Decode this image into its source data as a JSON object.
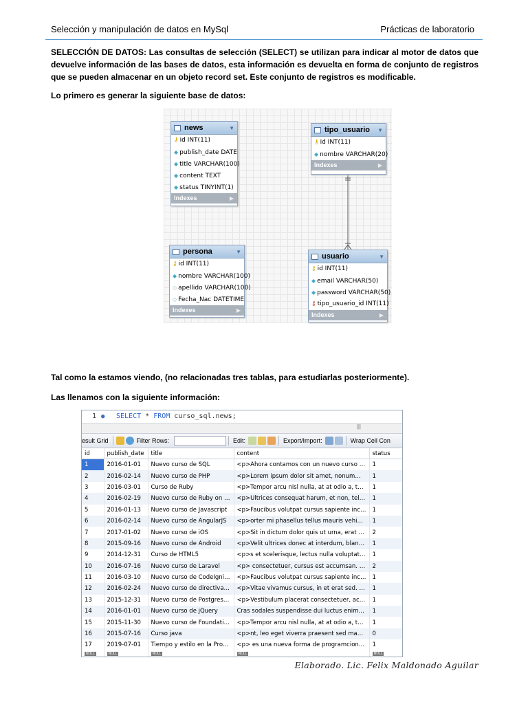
{
  "header": {
    "left": "Selección y manipulación de datos en   MySql",
    "right": "Prácticas de laboratorio"
  },
  "intro": {
    "lead": "SELECCIÓN DE DATOS:",
    "text": " Las consultas de selección (SELECT) se utilizan para indicar al motor de datos que devuelve información de las bases de datos, esta información es devuelta en forma de conjunto de registros que se pueden almacenar en un objeto record set. Este conjunto de registros es modificable."
  },
  "p1": "Lo primero es generar la siguiente base de datos:",
  "p2": "Tal como la estamos viendo, (no relacionadas tres tablas, para estudiarlas posteriormente).",
  "p3": "Las llenamos con la siguiente información:",
  "diagram": {
    "indexes_label": "Indexes",
    "news": {
      "name": "news",
      "cols": [
        "id INT(11)",
        "publish_date DATE",
        "title VARCHAR(100)",
        "content TEXT",
        "status TINYINT(1)"
      ]
    },
    "tipo_usuario": {
      "name": "tipo_usuario",
      "cols": [
        "id INT(11)",
        "nombre VARCHAR(20)"
      ]
    },
    "persona": {
      "name": "persona",
      "cols": [
        "id INT(11)",
        "nombre VARCHAR(100)",
        "apellido VARCHAR(100)",
        "Fecha_Nac DATETIME"
      ]
    },
    "usuario": {
      "name": "usuario",
      "cols": [
        "id INT(11)",
        "email VARCHAR(50)",
        "password VARCHAR(50)",
        "tipo_usuario_id INT(11)"
      ]
    }
  },
  "query": {
    "line_no": "1",
    "kw1": "SELECT",
    "star": " * ",
    "kw2": "FROM",
    "rest": " curso_sql.news;"
  },
  "toolbar": {
    "result_grid": "esult Grid",
    "filter_rows": "Filter Rows:",
    "edit": "Edit:",
    "export": "Export/Import:",
    "wrap": "Wrap Cell Con"
  },
  "grid": {
    "columns": [
      "id",
      "publish_date",
      "title",
      "content",
      "status"
    ],
    "rows": [
      [
        "1",
        "2016-01-01",
        "Nuevo curso de SQL",
        "<p>Ahora contamos con un nuevo curso de SQ...",
        "1"
      ],
      [
        "2",
        "2016-02-14",
        "Nuevo curso de PHP",
        "<p>Lorem ipsum dolor sit amet, nonummy arcu ...",
        "1"
      ],
      [
        "3",
        "2016-03-01",
        "Curso de Ruby",
        "<p>Tempor arcu nisl nulla, at at odio a, turpis d...",
        "1"
      ],
      [
        "4",
        "2016-02-19",
        "Nuevo curso de Ruby on Rails",
        "<p>Ultrices consequat harum, et non, tellus eu...",
        "1"
      ],
      [
        "5",
        "2016-01-13",
        "Nuevo curso de Javascript",
        "<p>Faucibus volutpat cursus sapiente inceptos...",
        "1"
      ],
      [
        "6",
        "2016-02-14",
        "Nuevo curso de AngularJS",
        "<p>orter mi phasellus tellus mauris vehicula, et ...",
        "1"
      ],
      [
        "7",
        "2017-01-02",
        "Nuevo curso de iOS",
        "<p>Sit in dictum dolor quis ut urna, erat vestib...",
        "2"
      ],
      [
        "8",
        "2015-09-16",
        "Nuevo curso de Android",
        "<p>Velit ultrices donec at interdum, blandit null...",
        "1"
      ],
      [
        "9",
        "2014-12-31",
        "Curso de HTML5",
        "<p>s et scelerisque, lectus nulla voluptatem lec...",
        "1"
      ],
      [
        "10",
        "2016-07-16",
        "Nuevo curso de Laravel",
        "<p> consectetuer, cursus est accumsan. Ferm...",
        "2"
      ],
      [
        "11",
        "2016-03-10",
        "Nuevo curso de CodeIgniter",
        "<p>Faucibus volutpat cursus sapiente inceptos...",
        "1"
      ],
      [
        "12",
        "2016-02-24",
        "Nuevo curso de directivas de ...",
        "<p>Vitae vivamus cursus, in et erat sed. Turpis...",
        "1"
      ],
      [
        "13",
        "2015-12-31",
        "Nuevo curso de PostgresSQL",
        "<p>Vestibulum placerat consectetuer, accusan...",
        "1"
      ],
      [
        "14",
        "2016-01-01",
        "Nuevo curso de jQuery",
        "Cras sodales suspendisse dui luctus enim, temp...",
        "1"
      ],
      [
        "15",
        "2015-11-30",
        "Nuevo curso de Foundation ...",
        "<p>Tempor arcu nisl nulla, at at odio a, turpis d...",
        "1"
      ],
      [
        "16",
        "2015-07-16",
        "Curso java",
        "<p>nt, leo eget viverra praesent sed mauris ph...",
        "0"
      ],
      [
        "17",
        "2019-07-01",
        "Tiempo y estilo en la Program...",
        "<p> es una nueva forma de programcion para...",
        "1"
      ]
    ],
    "null_label": "NULL"
  },
  "footer": "Elaborado. Lic. Felix Maldonado Aguilar",
  "colors": {
    "accent": "#5b9bd5",
    "selection": "#3875d7",
    "table_header": "#a9c5e2"
  }
}
